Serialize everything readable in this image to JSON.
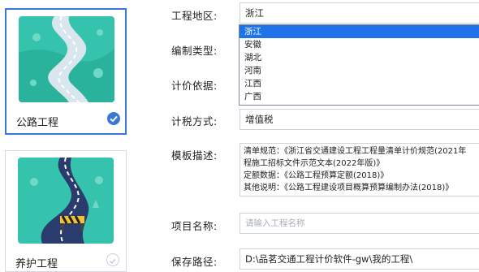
{
  "cards": [
    {
      "title": "公路工程",
      "selected": true,
      "thumb": "winding-road-icon"
    },
    {
      "title": "养护工程",
      "selected": false,
      "thumb": "road-maintenance-icon"
    }
  ],
  "form": {
    "region": {
      "label": "工程地区:",
      "value": "浙江"
    },
    "compile_type": {
      "label": "编制类型:"
    },
    "pricing_basis": {
      "label": "计价依据:"
    },
    "tax_method": {
      "label": "计税方式:",
      "value": "增值税"
    },
    "template_desc": {
      "label": "模板描述:",
      "lines": [
        "清单规范：《浙江省交通建设工程工程量清单计价规范(2021年",
        "程施工招标文件示范文本(2022年版)》",
        "定额数据：《公路工程预算定额(2018)》",
        "其他说明：《公路工程建设项目概算预算编制办法(2018)》"
      ]
    },
    "project_name": {
      "label": "项目名称:",
      "placeholder": "请输入工程名称"
    },
    "save_path": {
      "label": "保存路径:",
      "value": "D:\\品茗交通工程计价软件-gw\\我的工程\\"
    }
  },
  "region_dropdown": {
    "options": [
      "浙江",
      "安徽",
      "湖北",
      "河南",
      "江西",
      "广西"
    ],
    "selected_index": 0
  },
  "colors": {
    "accent": "#1e73e8",
    "selected_border": "#3a78d4",
    "card_bg": "#2bbfa8"
  }
}
